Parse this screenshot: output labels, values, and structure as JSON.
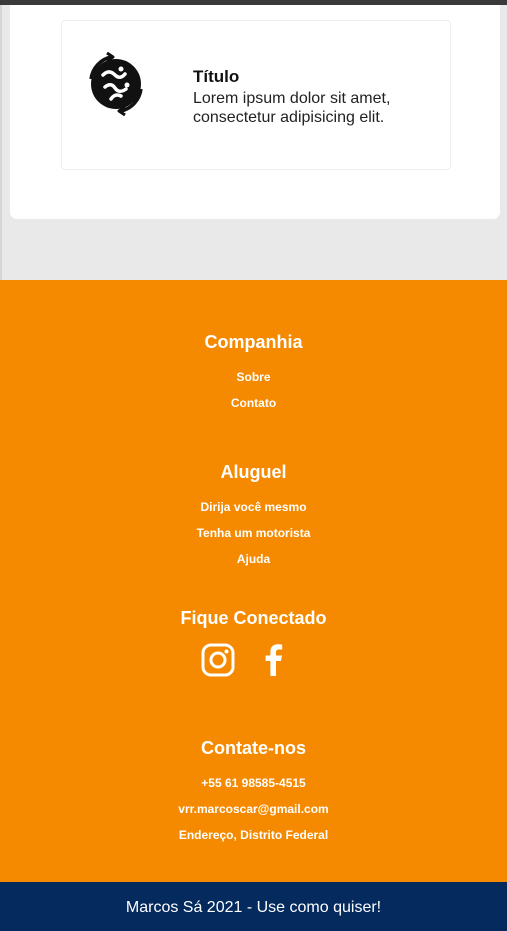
{
  "feature": {
    "icon": "cycle-brain-icon",
    "title": "Título",
    "text": "Lorem ipsum dolor sit amet, consectetur adipisicing elit."
  },
  "footer": {
    "company": {
      "title": "Companhia",
      "links": [
        "Sobre",
        "Contato"
      ]
    },
    "rental": {
      "title": "Aluguel",
      "links": [
        "Dirija você mesmo",
        "Tenha um motorista",
        "Ajuda"
      ]
    },
    "social": {
      "title": "Fique Conectado",
      "icons": [
        "instagram-icon",
        "facebook-icon"
      ]
    },
    "contact": {
      "title": "Contate-nos",
      "items": [
        "+55 61 98585-4515",
        "vrr.marcoscar@gmail.com",
        "Endereço, Distrito Federal"
      ]
    }
  },
  "bottom": {
    "copyright": "Marcos Sá 2021 - Use como quiser!"
  },
  "colors": {
    "footer_bg": "#f58a00",
    "bottom_bg": "#042a5e",
    "page_bg": "#e9e9e9"
  }
}
